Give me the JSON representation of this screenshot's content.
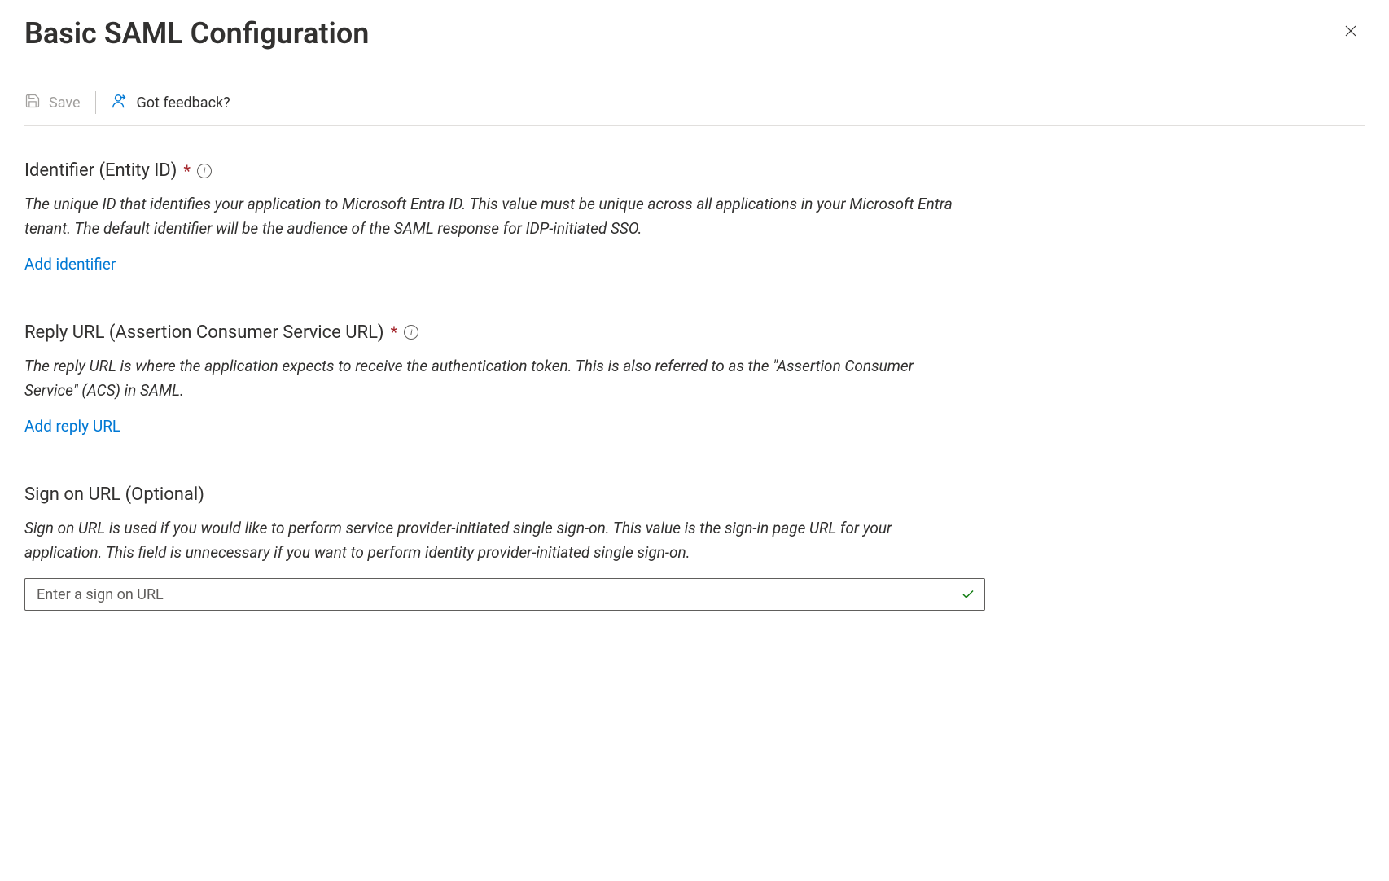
{
  "header": {
    "title": "Basic SAML Configuration"
  },
  "toolbar": {
    "save_label": "Save",
    "feedback_label": "Got feedback?"
  },
  "sections": {
    "identifier": {
      "title": "Identifier (Entity ID)",
      "required": true,
      "description": "The unique ID that identifies your application to Microsoft Entra ID. This value must be unique across all applications in your Microsoft Entra tenant. The default identifier will be the audience of the SAML response for IDP-initiated SSO.",
      "add_link_label": "Add identifier"
    },
    "reply_url": {
      "title": "Reply URL (Assertion Consumer Service URL)",
      "required": true,
      "description": "The reply URL is where the application expects to receive the authentication token. This is also referred to as the \"Assertion Consumer Service\" (ACS) in SAML.",
      "add_link_label": "Add reply URL"
    },
    "sign_on_url": {
      "title": "Sign on URL (Optional)",
      "required": false,
      "description": "Sign on URL is used if you would like to perform service provider-initiated single sign-on. This value is the sign-in page URL for your application. This field is unnecessary if you want to perform identity provider-initiated single sign-on.",
      "placeholder": "Enter a sign on URL",
      "value": ""
    }
  },
  "required_marker": "*"
}
